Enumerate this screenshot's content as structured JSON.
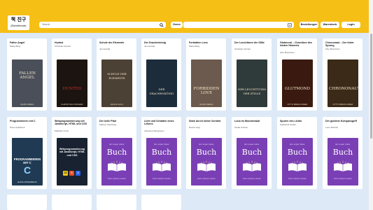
{
  "header": {
    "logo_line1": "책 친구",
    "logo_line2": "(Büchefreunde)",
    "search_placeholder": "Search",
    "genre_label": "Genre",
    "buttons": [
      "Bestellungen",
      "Warenkorb",
      "Login"
    ]
  },
  "books_row1": [
    {
      "title": "Fallen Angel",
      "author": "Maria Berg",
      "cover_title": "FALLEN ANGEL",
      "cover_author": "MARIA BERG",
      "cover_bg": "#4a4f5a"
    },
    {
      "title": "Hunted",
      "author": "Christian Fischer",
      "cover_title": "HUNTED",
      "cover_author": "CHRISTIAN FISCHER",
      "cover_bg": "#1b1410"
    },
    {
      "title": "Schule der Elemente",
      "author": "Jenna Falk",
      "cover_title": "SCHULE DER ELEMENTE",
      "cover_author": "JENNA FALK",
      "cover_bg": "#4c4135"
    },
    {
      "title": "Der Drachenkönig",
      "author": "Jenna Falk",
      "cover_title": "DER DRACHENKÖNIG",
      "cover_author": "",
      "cover_bg": "#1d2c3a"
    },
    {
      "title": "Forbidden Love",
      "author": "Maria Berg",
      "cover_title": "FORBIDDEN LOVE",
      "cover_author": "MARIA BERG",
      "cover_bg": "#6b5a4d"
    },
    {
      "title": "Der Leuchtturm der Stille",
      "author": "Christian Fischer",
      "cover_title": "DER LEUCHTTURM DER STILLE",
      "cover_author": "",
      "cover_bg": "#2f3a3a"
    },
    {
      "title": "Glutmond – Chroniken des letzten Himmels",
      "author": "Otto Breschner",
      "cover_title": "GLUTMOND",
      "cover_author": "OTTO BRESCHNER",
      "cover_bg": "#3a1a10"
    },
    {
      "title": "Chrononaut – Der letzte Sprung",
      "author": "Otto Breschner",
      "cover_title": "CHRONONAUT",
      "cover_author": "OTTO BRESCHNER",
      "cover_bg": "#3b2a18"
    }
  ],
  "books_row2": [
    {
      "title": "Programmieren mit C",
      "author": "Hans Apfelbeck",
      "cover_title": "PROGRAMMIEREN MIT C",
      "cover_author": "HANS APFELBECK",
      "cover_bg": "#1f3a52"
    },
    {
      "title": "Webprogrammierung mit JavaScript, HTML und CSS",
      "author": "Matthias Groß",
      "cover_title": "Webprogrammierung mit JavaScript, HTML und CSS",
      "cover_author": "",
      "cover_bg": "#182230"
    },
    {
      "title": "Der helle Pfad",
      "author": "Markus Steinberg",
      "cover_title": "Buch",
      "cover_author": "Vom einem Autor",
      "cover_bg": "#7a3fb5"
    },
    {
      "title": "Licht und Schatten eines Lebens",
      "author": "Johannes Bergmann",
      "cover_title": "Buch",
      "cover_author": "Vom einem Autor",
      "cover_bg": "#7a3fb5"
    },
    {
      "title": "Stark durch kleine Schritte",
      "author": "Daniel Vogt",
      "cover_title": "Buch",
      "cover_author": "Vom einem Autor",
      "cover_bg": "#7a3fb5"
    },
    {
      "title": "Luna im Wunderwald",
      "author": "Sarah Krämer",
      "cover_title": "Buch",
      "cover_author": "Vom einem Autor",
      "cover_bg": "#7a3fb5"
    },
    {
      "title": "Spuren des Lichts",
      "author": "Katharina Seidel",
      "cover_title": "Buch",
      "cover_author": "Vom einem Autor",
      "cover_bg": "#7a3fb5"
    },
    {
      "title": "Der goldene Kompassgriff",
      "author": "Leon Dietrich",
      "cover_title": "Buch",
      "cover_author": "Vom einem Autor",
      "cover_bg": "#7a3fb5"
    }
  ],
  "generic_cover_top": "Ein super tolles",
  "accent_color": "#f6bf16"
}
